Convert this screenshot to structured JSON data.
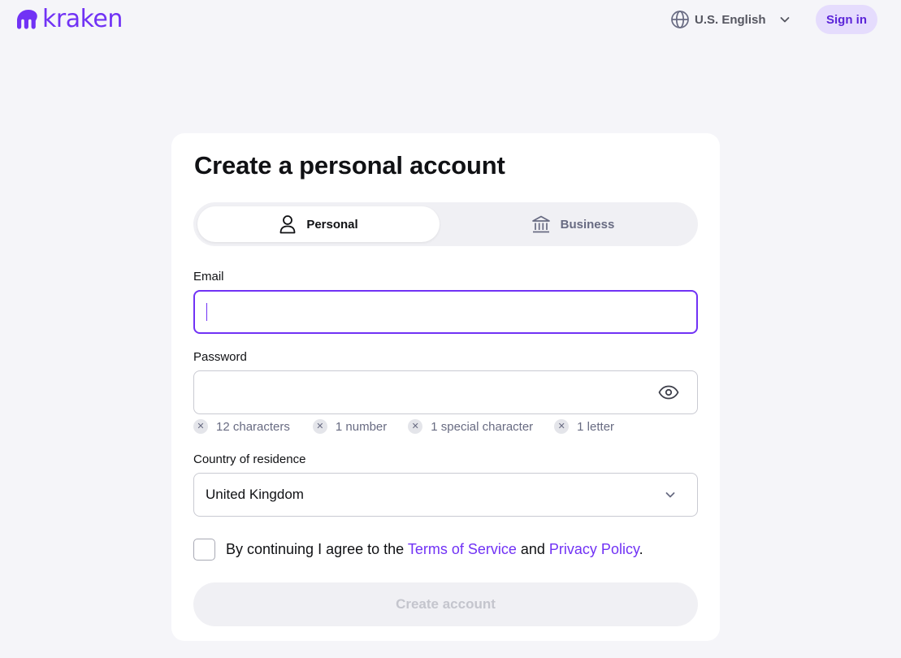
{
  "header": {
    "logo_text": "kraken",
    "language": "U.S. English",
    "signin_label": "Sign in"
  },
  "form": {
    "title": "Create a personal account",
    "tabs": [
      {
        "label": "Personal",
        "icon": "person-icon",
        "active": true
      },
      {
        "label": "Business",
        "icon": "bank-icon",
        "active": false
      }
    ],
    "email": {
      "label": "Email",
      "value": ""
    },
    "password": {
      "label": "Password",
      "value": ""
    },
    "password_rules": [
      "12 characters",
      "1 number",
      "1 special character",
      "1 letter"
    ],
    "country": {
      "label": "Country of residence",
      "value": "United Kingdom"
    },
    "agreement": {
      "prefix": "By continuing I agree to the ",
      "terms_link": "Terms of Service",
      "middle": " and ",
      "privacy_link": "Privacy Policy",
      "suffix": "."
    },
    "submit_label": "Create account"
  },
  "colors": {
    "accent": "#7132f5",
    "signin_bg": "#e5dcfd",
    "page_bg": "#f5f5f9"
  }
}
